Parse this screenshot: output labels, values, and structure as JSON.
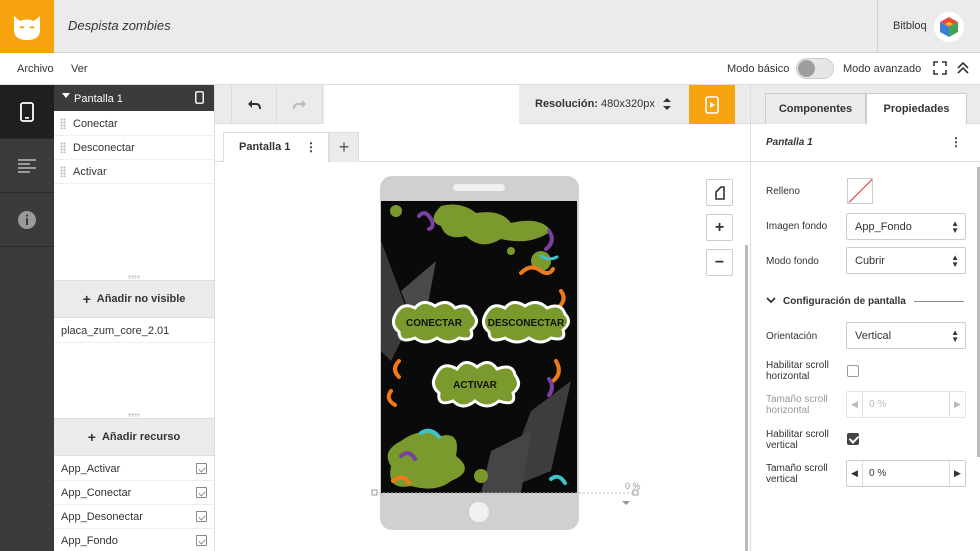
{
  "header": {
    "project_title": "Despista zombies",
    "app_name": "Bitbloq"
  },
  "menubar": {
    "items": [
      "Archivo",
      "Ver"
    ],
    "mode_basic": "Modo básico",
    "mode_advanced": "Modo avanzado",
    "mode_toggle_advanced": false
  },
  "left_panel": {
    "screen_name": "Pantalla 1",
    "components": [
      "Conectar",
      "Desconectar",
      "Activar"
    ],
    "add_invisible_label": "Añadir no visible",
    "invisible_items": [
      "placa_zum_core_2.01"
    ],
    "add_resource_label": "Añadir recurso",
    "resources": [
      "App_Activar",
      "App_Conectar",
      "App_Desonectar",
      "App_Fondo"
    ]
  },
  "center": {
    "resolution_label": "Resolución:",
    "resolution_value": "480x320px",
    "tab_label": "Pantalla 1",
    "tab_add": "+",
    "zoom_in": "+",
    "zoom_out": "−",
    "scroll_percent": "0 %",
    "preview_buttons": [
      "CONECTAR",
      "DESCONECTAR",
      "ACTIVAR"
    ]
  },
  "right_panel": {
    "tabs": [
      "Componentes",
      "Propiedades"
    ],
    "active_tab": "Propiedades",
    "title": "Pantalla 1",
    "props": {
      "fill_label": "Relleno",
      "bg_image_label": "Imagen fondo",
      "bg_image_value": "App_Fondo",
      "bg_mode_label": "Modo fondo",
      "bg_mode_value": "Cubrir",
      "section_label": "Configuración de pantalla",
      "orientation_label": "Orientación",
      "orientation_value": "Vertical",
      "hscroll_enable_label_1": "Habilitar scroll",
      "hscroll_enable_label_2": "horizontal",
      "hscroll_enabled": false,
      "hscroll_size_label_1": "Tamaño scroll",
      "hscroll_size_label_2": "horizontal",
      "hscroll_size_value": "0 %",
      "vscroll_enable_label_1": "Habilitar scroll",
      "vscroll_enable_label_2": "vertical",
      "vscroll_enabled": true,
      "vscroll_size_label_1": "Tamaño scroll",
      "vscroll_size_label_2": "vertical",
      "vscroll_size_value": "0 %"
    }
  },
  "colors": {
    "accent": "#f7a30f",
    "rail_bg": "#3b3b3b",
    "splat_green": "#7a9a2e",
    "worm_purple": "#7b3fa0",
    "worm_orange": "#f07a1a",
    "worm_teal": "#3ec1c9"
  }
}
